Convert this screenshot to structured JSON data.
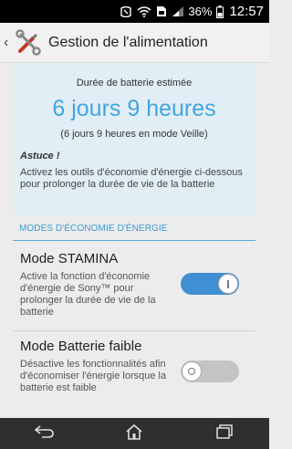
{
  "status_bar": {
    "icons": [
      "nfc-icon",
      "wifi-icon",
      "sim-icon",
      "signal-icon",
      "battery-icon"
    ],
    "battery": "36%",
    "time": "12:57"
  },
  "action_bar": {
    "title": "Gestion de l'alimentation",
    "icon": "tools-icon"
  },
  "battery_estimate": {
    "label": "Durée de batterie estimée",
    "value": "6 jours 9 heures",
    "standby_note": "(6 jours 9 heures en mode Veille)"
  },
  "tip": {
    "title": "Astuce !",
    "text": "Activez les outils d'économie d'énergie ci-dessous pour prolonger la durée de vie de la batterie"
  },
  "section": {
    "header": "MODES D'ÉCONOMIE D'ÉNERGIE"
  },
  "modes": [
    {
      "title": "Mode STAMINA",
      "description": "Active la fonction d'économie d'énergie de Sony™ pour prolonger la durée de vie de la batterie",
      "enabled": true
    },
    {
      "title": "Mode Batterie faible",
      "description": "Désactive les fonctionnalités afin d'économiser l'énergie lorsque la batterie est faible",
      "enabled": false
    }
  ],
  "nav_bar": {
    "buttons": [
      "back-icon",
      "home-icon",
      "recent-apps-icon"
    ]
  },
  "colors": {
    "accent": "#40a6e0",
    "toggle_on": "#3f8fd2",
    "toggle_off": "#c4c4c4"
  }
}
